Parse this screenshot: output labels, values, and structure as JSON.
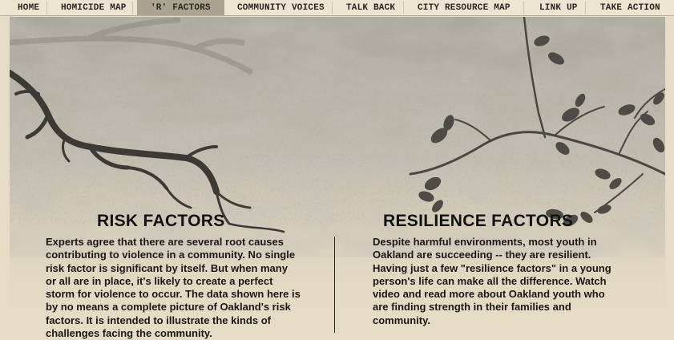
{
  "nav": {
    "items": [
      {
        "label": "HOME",
        "active": false
      },
      {
        "label": "HOMICIDE MAP",
        "active": false
      },
      {
        "label": "'R' FACTORS",
        "active": true
      },
      {
        "label": "COMMUNITY VOICES",
        "active": false
      },
      {
        "label": "TALK BACK",
        "active": false
      },
      {
        "label": "CITY RESOURCE MAP",
        "active": false
      },
      {
        "label": "LINK UP",
        "active": false
      },
      {
        "label": "TAKE ACTION",
        "active": false
      }
    ]
  },
  "risk": {
    "heading": "RISK FACTORS",
    "body": "Experts agree that there are several root causes contributing to violence in a community. No single risk factor is significant by itself. But when many or all are in place, it's likely to create a perfect storm for violence to occur. The data shown here is by no means a complete picture of Oakland's risk factors. It is intended to illustrate the kinds of challenges facing the community."
  },
  "resilience": {
    "heading": "RESILIENCE FACTORS",
    "body": "Despite harmful environments, most youth in Oakland are succeeding -- they are resilient. Having just a few \"resilience factors\" in a young person's life can make all the difference. Watch video and read more about Oakland youth who are finding strength in their families and community."
  },
  "colors": {
    "background": "#e6dcc6",
    "nav_active": "#aaa392",
    "texture": "#a8a398",
    "branches": "#3d3a36"
  }
}
